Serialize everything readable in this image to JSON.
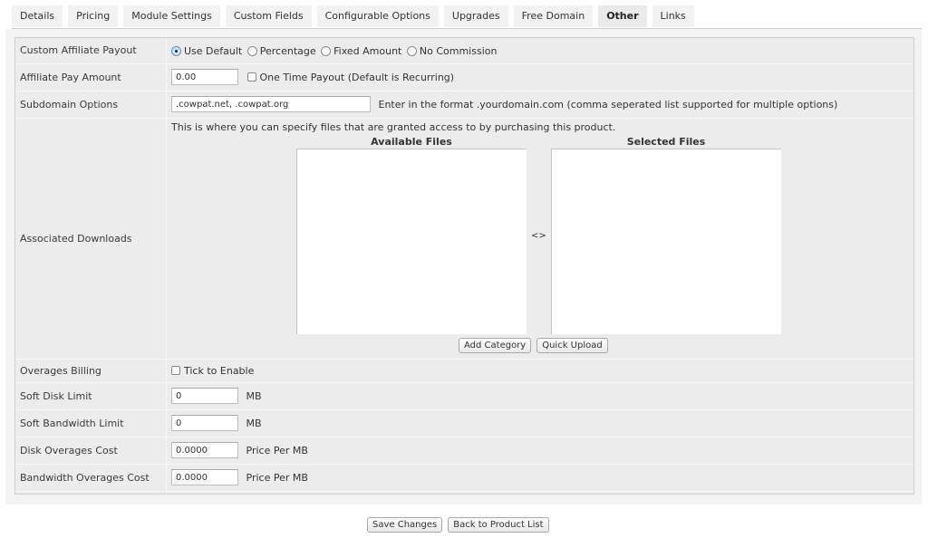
{
  "tabs": [
    {
      "label": "Details",
      "active": false
    },
    {
      "label": "Pricing",
      "active": false
    },
    {
      "label": "Module Settings",
      "active": false
    },
    {
      "label": "Custom Fields",
      "active": false
    },
    {
      "label": "Configurable Options",
      "active": false
    },
    {
      "label": "Upgrades",
      "active": false
    },
    {
      "label": "Free Domain",
      "active": false
    },
    {
      "label": "Other",
      "active": true
    },
    {
      "label": "Links",
      "active": false
    }
  ],
  "form": {
    "custom_affiliate_payout": {
      "label": "Custom Affiliate Payout",
      "options": [
        {
          "label": "Use Default",
          "selected": true
        },
        {
          "label": "Percentage",
          "selected": false
        },
        {
          "label": "Fixed Amount",
          "selected": false
        },
        {
          "label": "No Commission",
          "selected": false
        }
      ]
    },
    "affiliate_pay_amount": {
      "label": "Affiliate Pay Amount",
      "value": "0.00",
      "one_time_label": "One Time Payout (Default is Recurring)",
      "one_time_checked": false
    },
    "subdomain_options": {
      "label": "Subdomain Options",
      "value": ".cowpat.net, .cowpat.org",
      "hint": "Enter in the format .yourdomain.com (comma seperated list supported for multiple options)"
    },
    "associated_downloads": {
      "label": "Associated Downloads",
      "description": "This is where you can specify files that are granted access to by purchasing this product.",
      "available_header": "Available Files",
      "selected_header": "Selected Files",
      "available_files": [],
      "selected_files": [],
      "swap_label": "<>",
      "add_category_label": "Add Category",
      "quick_upload_label": "Quick Upload"
    },
    "overages_billing": {
      "label": "Overages Billing",
      "checkbox_label": "Tick to Enable",
      "checked": false
    },
    "soft_disk_limit": {
      "label": "Soft Disk Limit",
      "value": "0",
      "unit": "MB"
    },
    "soft_bandwidth_limit": {
      "label": "Soft Bandwidth Limit",
      "value": "0",
      "unit": "MB"
    },
    "disk_overages_cost": {
      "label": "Disk Overages Cost",
      "value": "0.0000",
      "unit": "Price Per MB"
    },
    "bandwidth_overages_cost": {
      "label": "Bandwidth Overages Cost",
      "value": "0.0000",
      "unit": "Price Per MB"
    }
  },
  "actions": {
    "save_label": "Save Changes",
    "back_label": "Back to Product List"
  }
}
